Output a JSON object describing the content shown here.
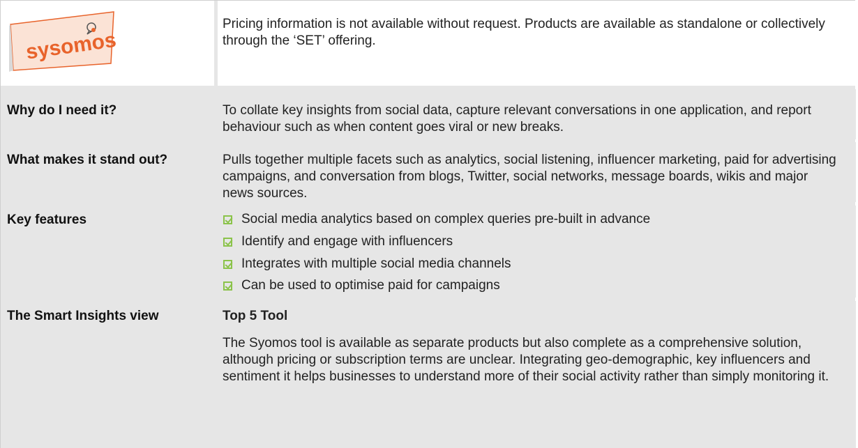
{
  "logo": {
    "brand_text": "sysomos"
  },
  "intro": {
    "text": "Pricing information is not available without request. Products are available as standalone or collectively through the ‘SET’ offering."
  },
  "rows": {
    "why": {
      "label": "Why do I need it?",
      "text": "To collate key insights from social data, capture relevant conversations in one application, and report behaviour such as when content goes viral or new breaks."
    },
    "standout": {
      "label": "What makes it stand out?",
      "text": "Pulls together multiple facets such as analytics, social listening, influencer marketing, paid for advertising campaigns, and conversation from blogs, Twitter, social networks, message boards, wikis and major news sources."
    },
    "features": {
      "label": "Key features",
      "items": [
        "Social media analytics based on complex queries pre-built in advance",
        "Identify and engage with influencers",
        "Integrates with multiple social media channels",
        "Can be used to optimise paid for campaigns"
      ]
    },
    "view": {
      "label": "The Smart Insights view",
      "subtitle": "Top 5 Tool",
      "text": "The Syomos tool is available as separate products but also complete as a comprehensive solution, although pricing or subscription terms are unclear. Integrating geo-demographic, key influencers and sentiment it helps businesses to understand more of their social activity rather than simply monitoring it."
    }
  },
  "colors": {
    "check": "#8bc34a",
    "cell_gray": "#e6e6e6",
    "logo_orange": "#e8632b"
  }
}
